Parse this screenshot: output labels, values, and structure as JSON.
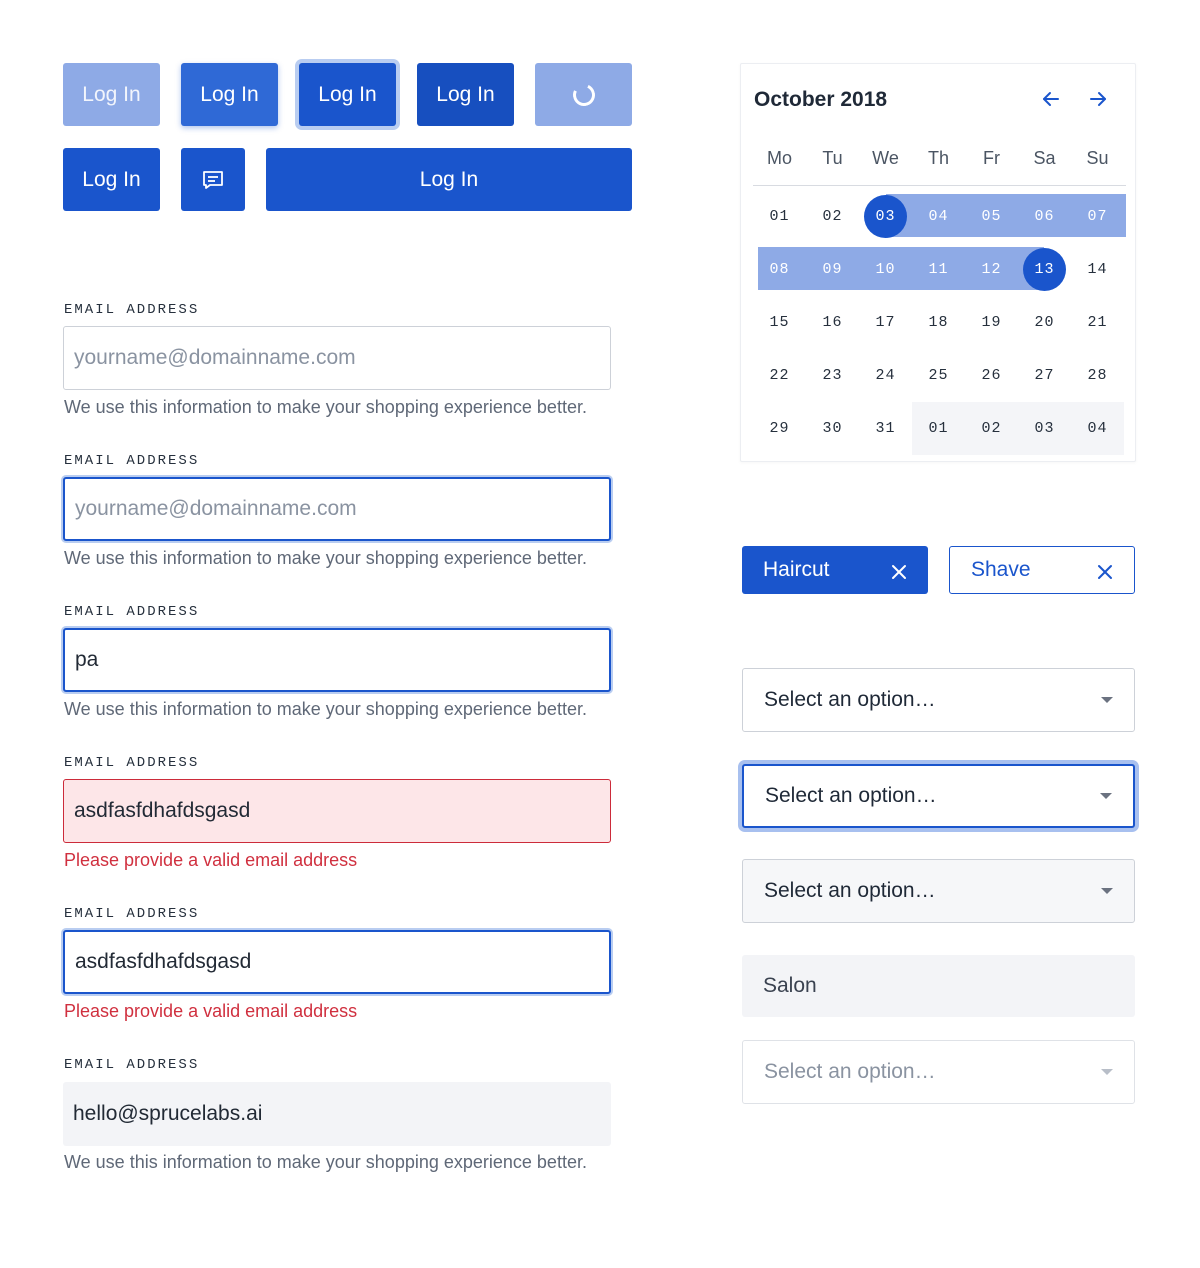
{
  "buttons": {
    "row1": [
      "Log In",
      "Log In",
      "Log In",
      "Log In"
    ],
    "row2_small": "Log In",
    "row2_wide": "Log In"
  },
  "fields": [
    {
      "label": "EMAIL ADDRESS",
      "value": "",
      "placeholder": "yourname@domainname.com",
      "help": "We use this information to make your shopping experience better.",
      "state": "default"
    },
    {
      "label": "EMAIL ADDRESS",
      "value": "",
      "placeholder": "yourname@domainname.com",
      "help": "We use this information to make your shopping experience better.",
      "state": "focus"
    },
    {
      "label": "EMAIL ADDRESS",
      "value": "pa",
      "placeholder": "",
      "help": "We use this information to make your shopping experience better.",
      "state": "focus"
    },
    {
      "label": "EMAIL ADDRESS",
      "value": "asdfasfdhafdsgasd",
      "placeholder": "",
      "help": "Please provide a valid email address",
      "state": "error"
    },
    {
      "label": "EMAIL ADDRESS",
      "value": "asdfasfdhafdsgasd",
      "placeholder": "",
      "help": "Please provide a valid email address",
      "state": "error-focus"
    },
    {
      "label": "EMAIL ADDRESS",
      "value": "hello@sprucelabs.ai",
      "placeholder": "",
      "help": "We use this information to make your shopping experience better.",
      "state": "disabled"
    }
  ],
  "calendar": {
    "title": "October 2018",
    "weekdays": [
      "Mo",
      "Tu",
      "We",
      "Th",
      "Fr",
      "Sa",
      "Su"
    ],
    "weeks": [
      [
        "01",
        "02",
        "03",
        "04",
        "05",
        "06",
        "07"
      ],
      [
        "08",
        "09",
        "10",
        "11",
        "12",
        "13",
        "14"
      ],
      [
        "15",
        "16",
        "17",
        "18",
        "19",
        "20",
        "21"
      ],
      [
        "22",
        "23",
        "24",
        "25",
        "26",
        "27",
        "28"
      ],
      [
        "29",
        "30",
        "31",
        "01",
        "02",
        "03",
        "04"
      ]
    ],
    "range_start": "03",
    "range_end": "13"
  },
  "tags": [
    {
      "label": "Haircut",
      "style": "filled"
    },
    {
      "label": "Shave",
      "style": "outline"
    }
  ],
  "selects": [
    {
      "value": "Select an option…",
      "state": "default"
    },
    {
      "value": "Select an option…",
      "state": "focus"
    },
    {
      "value": "Select an option…",
      "state": "hover"
    },
    {
      "value": "Salon",
      "state": "readonly"
    },
    {
      "value": "Select an option…",
      "state": "disabled"
    }
  ],
  "colors": {
    "primary": "#1a55cc",
    "primary_light": "#8eaae6",
    "error": "#d0303f",
    "error_bg": "#fde6e8"
  },
  "icons": {
    "loading": "spinner-icon",
    "message": "chat-icon",
    "prev": "arrow-left-icon",
    "next": "arrow-right-icon",
    "remove": "close-icon",
    "dropdown": "caret-down-icon"
  }
}
